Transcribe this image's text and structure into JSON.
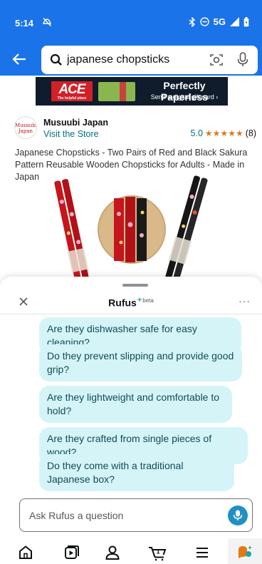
{
  "status_bar": {
    "time": "5:14",
    "network": "5G",
    "icons": [
      "do-not-disturb-icon",
      "bluetooth-icon",
      "minus-circle-icon",
      "signal-icon",
      "battery-icon"
    ]
  },
  "search": {
    "query": "japanese chopsticks",
    "icons": [
      "back-arrow-icon",
      "search-icon",
      "camera-scan-icon",
      "microphone-icon"
    ]
  },
  "ad_banner": {
    "brand": "ACE",
    "brand_tagline": "The helpful place",
    "title": "Perfectly Paperless",
    "subtitle": "Send a digital gift card ›"
  },
  "product": {
    "brand_logo_text": "Musuubi Japan",
    "brand_name": "Musuubi Japan",
    "store_link": "Visit the Store",
    "rating_value": "5.0",
    "stars": "★★★★★",
    "rating_count": "(8)",
    "title": "Japanese Chopsticks - Two Pairs of Red and Black Sakura Pattern Reusable Wooden Chopsticks for Adults - Made in Japan"
  },
  "rufus": {
    "title": "Rufus",
    "plus": "+",
    "badge": "beta",
    "more": "···",
    "suggestions": [
      "Are they dishwasher safe for easy cleaning?",
      "Do they prevent slipping and provide good grip?",
      "Are they lightweight and comfortable to hold?",
      "Are they crafted from single pieces of wood?",
      "Do they come with a traditional Japanese box?"
    ],
    "input_placeholder": "Ask Rufus a question"
  },
  "bottom_nav": {
    "items": [
      "home-icon",
      "video-icon",
      "account-icon",
      "cart-icon",
      "menu-icon",
      "rufus-icon"
    ],
    "cart_count": "1"
  },
  "colors": {
    "header_blue": "#1a73e8",
    "link_teal": "#007185",
    "star_orange": "#de7921",
    "chip_bg": "#d5f4f8",
    "mic_blue": "#1f90c4"
  }
}
